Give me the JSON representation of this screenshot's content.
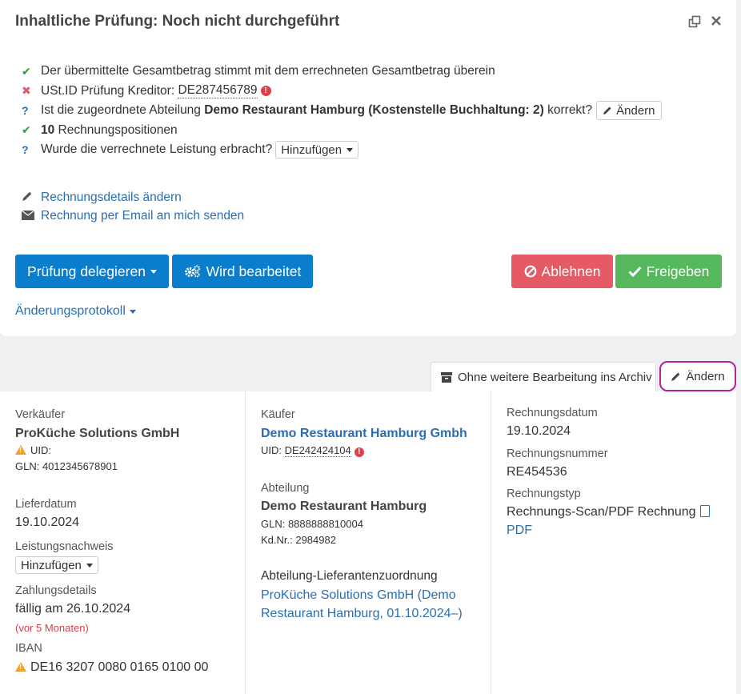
{
  "header": {
    "title": "Inhaltliche Prüfung: Noch nicht durchgeführt",
    "restore_icon": "restore-window-icon",
    "close_icon": "close-icon"
  },
  "checks": [
    {
      "icon": "check-icon",
      "text": "Der übermittelte Gesamtbetrag stimmt mit dem errechneten Gesamtbetrag überein"
    },
    {
      "icon": "cross-icon",
      "prefix": "USt.ID Prüfung Kreditor: ",
      "value": "DE287456789"
    },
    {
      "icon": "question-icon",
      "prefix": "Ist die zugeordnete Abteilung ",
      "bold": "Demo Restaurant Hamburg (Kostenstelle Buchhaltung: 2)",
      "suffix": " korrekt?",
      "button": "Ändern"
    },
    {
      "icon": "check-icon",
      "bold": "10",
      "suffix": " Rechnungspositionen"
    },
    {
      "icon": "question-icon",
      "prefix": "Wurde die verrechnete Leistung erbracht?",
      "select": "Hinzufügen"
    }
  ],
  "links": {
    "edit_details": "Rechnungsdetails ändern",
    "send_email": "Rechnung per Email an mich senden"
  },
  "actions": {
    "delegate": "Prüfung delegieren",
    "in_progress": "Wird bearbeitet",
    "reject": "Ablehnen",
    "approve": "Freigeben",
    "protocol": "Änderungsprotokoll"
  },
  "tabs": {
    "archive": "Ohne weitere Bearbeitung ins Archiv",
    "edit": "Ändern"
  },
  "seller": {
    "label": "Verkäufer",
    "name": "ProKüche Solutions GmbH",
    "uid_label": "UID:",
    "gln": "GLN: 4012345678901"
  },
  "delivery": {
    "label": "Lieferdatum",
    "value": "19.10.2024"
  },
  "proof": {
    "label": "Leistungsnachweis",
    "select": "Hinzufügen"
  },
  "payment": {
    "label": "Zahlungsdetails",
    "due": "fällig am 26.10.2024",
    "relative": "(vor 5 Monaten)"
  },
  "iban": {
    "label": "IBAN",
    "value": "DE16 3207 0080 0165 0100 00"
  },
  "buyer": {
    "label": "Käufer",
    "name": "Demo Restaurant Hamburg Gmbh",
    "uid_label": "UID: ",
    "uid_value": "DE242424104"
  },
  "department": {
    "label": "Abteilung",
    "name": "Demo Restaurant Hamburg",
    "gln": "GLN: 8888888810004",
    "customer_no": "Kd.Nr.: 2984982"
  },
  "supplier_assignment": {
    "label": "Abteilung-Lieferantenzuordnung",
    "line1": "ProKüche Solutions GmbH (Demo",
    "line2": "Restaurant Hamburg, 01.10.2024–)"
  },
  "invoice": {
    "date_label": "Rechnungsdatum",
    "date": "19.10.2024",
    "number_label": "Rechnungsnummer",
    "number": "RE454536",
    "type_label": "Rechnungstyp",
    "type": "Rechnungs-Scan/PDF Rechnung",
    "pdf_link": "PDF"
  }
}
